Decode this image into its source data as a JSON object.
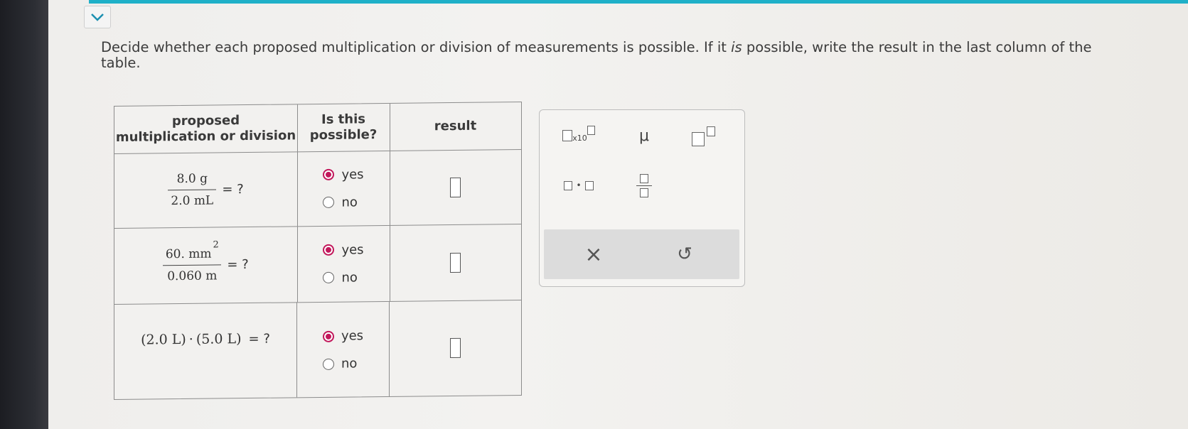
{
  "prompt": {
    "part1": "Decide whether each proposed multiplication or division of measurements is possible. If it ",
    "italic": "is",
    "part2": " possible, write the result in the last column of the table."
  },
  "table": {
    "headers": {
      "col1_line1": "proposed",
      "col1_line2": "multiplication or division",
      "col2_line1": "Is this",
      "col2_line2": "possible?",
      "col3": "result"
    },
    "rows": [
      {
        "numerator": "8.0 g",
        "denominator": "2.0 mL",
        "equals": "= ?",
        "yes_label": "yes",
        "no_label": "no",
        "selected": "yes"
      },
      {
        "numerator": "60. mm",
        "exponent": "2",
        "denominator": "0.060 m",
        "equals": "= ?",
        "yes_label": "yes",
        "no_label": "no",
        "selected": "yes"
      },
      {
        "expression_a": "(2.0 L)",
        "dot": "·",
        "expression_b": "(5.0 L)",
        "equals": "= ?",
        "yes_label": "yes",
        "no_label": "no",
        "selected": "yes"
      }
    ]
  },
  "palette": {
    "sci_label": "x10",
    "mu_symbol": "μ",
    "clear_symbol": "×",
    "undo_symbol": "↺",
    "dot_symbol": "•"
  },
  "colors": {
    "accent_bar": "#1fb0c8",
    "radio_selected": "#c2185b"
  }
}
